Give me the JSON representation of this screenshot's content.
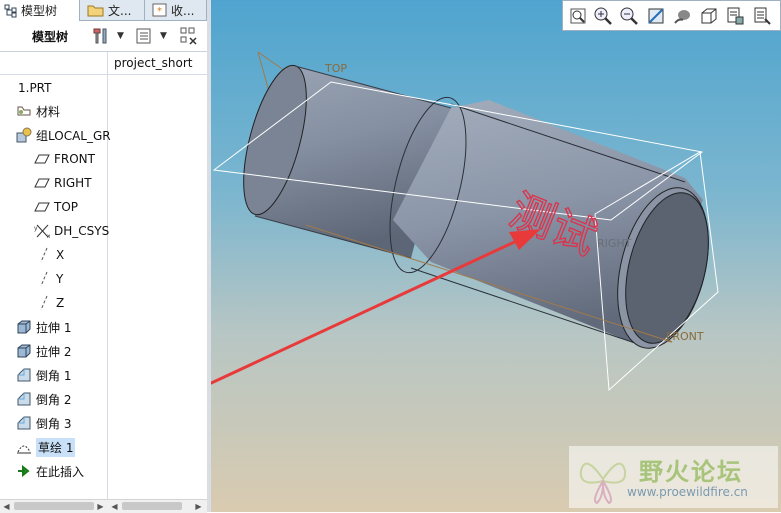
{
  "tabs": [
    {
      "label": "模型树",
      "icon": "model-tree-icon"
    },
    {
      "label": "文...",
      "icon": "folder-icon"
    },
    {
      "label": "收...",
      "icon": "favorites-icon"
    }
  ],
  "toolbar": {
    "title": "模型树"
  },
  "columns": {
    "col2": "project_short"
  },
  "tree": [
    {
      "label": "1.PRT",
      "icon": "none"
    },
    {
      "label": "材料",
      "icon": "material-icon"
    },
    {
      "label": "组LOCAL_GR",
      "icon": "group-icon"
    },
    {
      "label": "FRONT",
      "icon": "datum-plane-icon"
    },
    {
      "label": "RIGHT",
      "icon": "datum-plane-icon"
    },
    {
      "label": "TOP",
      "icon": "datum-plane-icon"
    },
    {
      "label": "DH_CSYS",
      "icon": "csys-icon"
    },
    {
      "label": "X",
      "icon": "datum-axis-icon"
    },
    {
      "label": "Y",
      "icon": "datum-axis-icon"
    },
    {
      "label": "Z",
      "icon": "datum-axis-icon"
    },
    {
      "label": "拉伸 1",
      "icon": "extrude-icon"
    },
    {
      "label": "拉伸 2",
      "icon": "extrude-icon"
    },
    {
      "label": "倒角 1",
      "icon": "chamfer-icon"
    },
    {
      "label": "倒角 2",
      "icon": "chamfer-icon"
    },
    {
      "label": "倒角 3",
      "icon": "chamfer-icon"
    },
    {
      "label": "草绘 1",
      "icon": "sketch-icon",
      "selected": true
    },
    {
      "label": "在此插入",
      "icon": "insert-here-icon"
    }
  ],
  "viewport": {
    "plane_labels": {
      "top": "TOP",
      "front": "FRONT",
      "right": "RIGHT"
    },
    "sketch_text": "测试",
    "arrow_color": "#e83a3a",
    "sketch_color": "#e0304a"
  },
  "graphics_toolbar": [
    "refit-icon",
    "zoom-in-icon",
    "zoom-out-icon",
    "repaint-icon",
    "shading-icon",
    "saved-views-icon",
    "datum-display-icon",
    "annotation-display-icon"
  ],
  "watermark": {
    "brand": "野火论坛",
    "url": "www.proewildfire.cn"
  }
}
